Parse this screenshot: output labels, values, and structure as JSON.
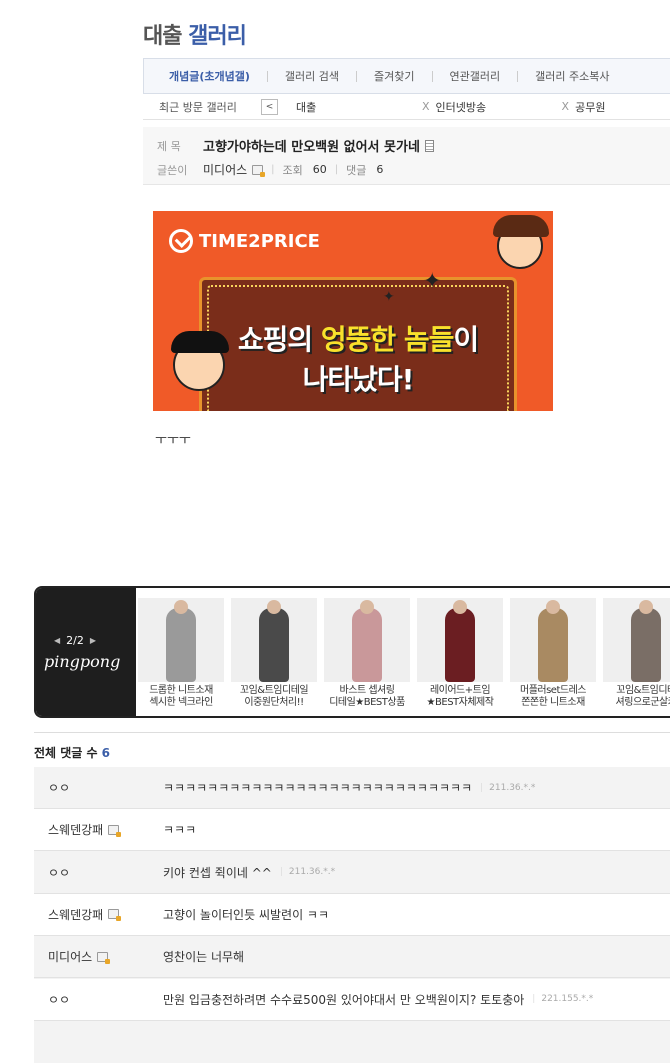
{
  "gallery": {
    "title_main": "대출",
    "title_sub": "갤러리"
  },
  "nav": {
    "items": [
      "개념글(초개념갤)",
      "갤러리 검색",
      "즐겨찾기",
      "연관갤러리",
      "갤러리 주소복사"
    ]
  },
  "recent": {
    "label": "최근 방문 갤러리",
    "prev": "<",
    "items": [
      "대출",
      "인터넷방송",
      "공무원"
    ],
    "remove": "X"
  },
  "post": {
    "title_label": "제 목",
    "title": "고향가야하는데 만오백원 없어서 못가네",
    "author_label": "글쓴이",
    "author": "미디어스",
    "views_label": "조회",
    "views": "60",
    "comments_label": "댓글",
    "comments": "6",
    "body": "ㅜㅜㅜ"
  },
  "banner": {
    "logo": "TIME2PRICE",
    "line1_a": "쇼핑의 ",
    "line1_hl": "엉뚱한 놈들",
    "line1_b": "이",
    "line2": "나타났다!"
  },
  "product_strip": {
    "page": "2/2",
    "prev": "◀",
    "next": "▶",
    "logo": "pingpong",
    "products": [
      {
        "line1": "드롭한 니트소재",
        "line2": "섹시한 넥크라인",
        "color": "#9a9a9a"
      },
      {
        "line1": "꼬임&트임디테일",
        "line2": "이중원단처리!!",
        "color": "#4a4a4a"
      },
      {
        "line1": "바스트 셉셔링",
        "line2": "디테일★BEST상품",
        "color": "#c9989a"
      },
      {
        "line1": "레이어드+트임",
        "line2": "★BEST자체제작",
        "color": "#6b1e22"
      },
      {
        "line1": "머플러set드레스",
        "line2": "쫀쫀한 니트소재",
        "color": "#a98a62"
      },
      {
        "line1": "꼬임&트임디테",
        "line2": "셔링으로군살커",
        "color": "#7a6e66"
      }
    ]
  },
  "comments": {
    "header": "전체 댓글 수",
    "count": "6",
    "items": [
      {
        "name": "ㅇㅇ",
        "fixed": false,
        "text": "ㅋㅋㅋㅋㅋㅋㅋㅋㅋㅋㅋㅋㅋㅋㅋㅋㅋㅋㅋㅋㅋㅋㅋㅋㅋㅋㅋㅋ",
        "ip": "211.36.*.*"
      },
      {
        "name": "스웨덴강패",
        "fixed": true,
        "text": "ㅋㅋㅋ",
        "ip": ""
      },
      {
        "name": "ㅇㅇ",
        "fixed": false,
        "text": "키야 컨셉 쥑이네 ^^",
        "ip": "211.36.*.*"
      },
      {
        "name": "스웨덴강패",
        "fixed": true,
        "text": "고향이 놀이터인듯 씨발련이 ㅋㅋ",
        "ip": ""
      },
      {
        "name": "미디어스",
        "fixed": true,
        "text": "영찬이는 너무해",
        "ip": ""
      },
      {
        "name": "ㅇㅇ",
        "fixed": false,
        "text": "만원 입금충전하려면 수수료500원 있어야대서 만 오백원이지? 토토충아",
        "ip": "221.155.*.*"
      }
    ]
  }
}
